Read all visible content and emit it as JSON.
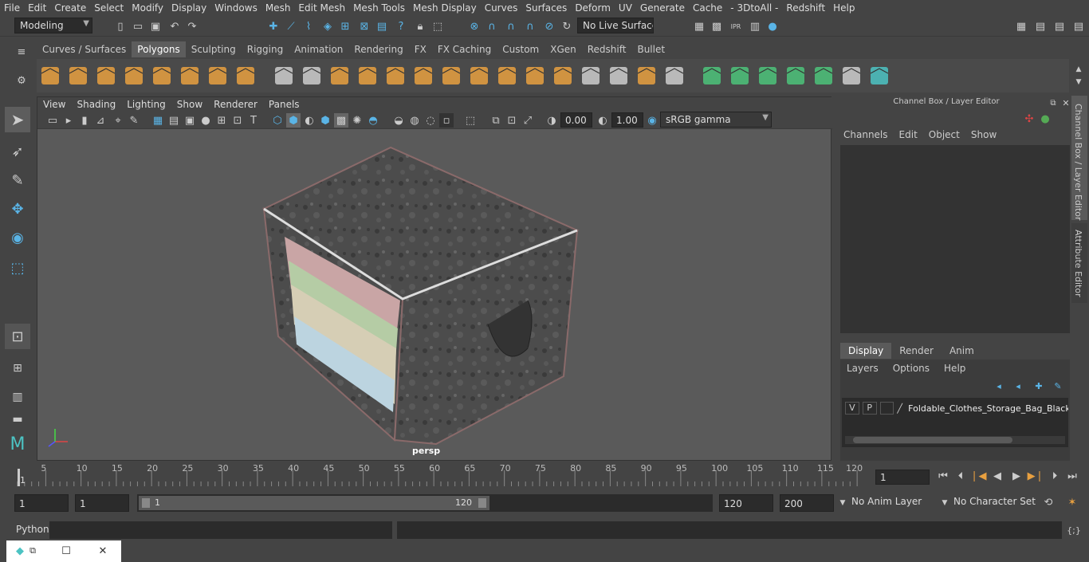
{
  "menus": [
    "File",
    "Edit",
    "Create",
    "Select",
    "Modify",
    "Display",
    "Windows",
    "Mesh",
    "Edit Mesh",
    "Mesh Tools",
    "Mesh Display",
    "Curves",
    "Surfaces",
    "Deform",
    "UV",
    "Generate",
    "Cache",
    "- 3DtoAll -",
    "Redshift",
    "Help"
  ],
  "status": {
    "mode": "Modeling",
    "live_surface": "No Live Surface"
  },
  "shelf_tabs": [
    "Curves / Surfaces",
    "Polygons",
    "Sculpting",
    "Rigging",
    "Animation",
    "Rendering",
    "FX",
    "FX Caching",
    "Custom",
    "XGen",
    "Redshift",
    "Bullet"
  ],
  "shelf_active": "Polygons",
  "viewport": {
    "menus": [
      "View",
      "Shading",
      "Lighting",
      "Show",
      "Renderer",
      "Panels"
    ],
    "exposure": "0.00",
    "gamma": "1.00",
    "colorspace": "sRGB gamma",
    "camera": "persp"
  },
  "channel_box": {
    "title": "Channel Box / Layer Editor",
    "menus": [
      "Channels",
      "Edit",
      "Object",
      "Show"
    ],
    "tabs": [
      "Display",
      "Render",
      "Anim"
    ],
    "layer_menus": [
      "Layers",
      "Options",
      "Help"
    ],
    "layer": {
      "v": "V",
      "p": "P",
      "name": "Foldable_Clothes_Storage_Bag_Black"
    },
    "side_tabs": [
      "Channel Box / Layer Editor",
      "Attribute Editor"
    ]
  },
  "timeline": {
    "ticks": [
      "5",
      "10",
      "15",
      "20",
      "25",
      "30",
      "35",
      "40",
      "45",
      "50",
      "55",
      "60",
      "65",
      "70",
      "75",
      "80",
      "85",
      "90",
      "95",
      "100",
      "105",
      "110",
      "115",
      "120"
    ],
    "start": "1",
    "current": "1"
  },
  "range": {
    "start": "1",
    "start2": "1",
    "slider_start": "1",
    "slider_end": "120",
    "end": "120",
    "end2": "200",
    "anim_layer": "No Anim Layer",
    "char_set": "No Character Set"
  },
  "cmd": {
    "label": "Python"
  },
  "colors": {
    "bg": "#444444",
    "viewport": "#5a5a5a",
    "active_tab": "#5d5d5d",
    "accent": "#4cc3c3"
  }
}
